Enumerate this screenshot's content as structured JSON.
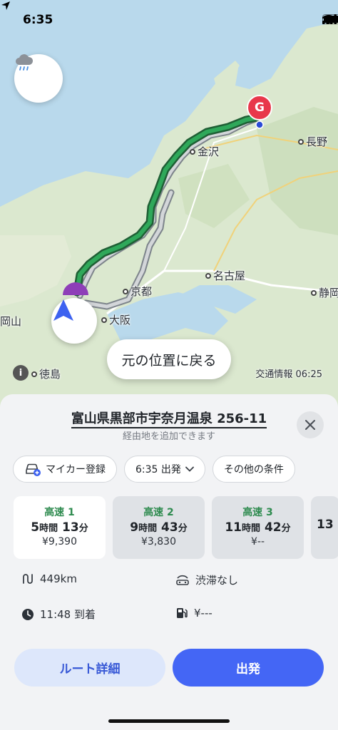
{
  "status_bar": {
    "time": "6:35"
  },
  "map": {
    "labels": {
      "kanazawa": "金沢",
      "nagano": "長野",
      "nagoya": "名古屋",
      "kyoto": "京都",
      "osaka": "大阪",
      "shizuoka": "静岡",
      "okayama": "岡山",
      "tokushima": "徳島"
    },
    "goal_marker": "G",
    "return_button": "元の位置に戻る",
    "info_icon_glyph": "i",
    "traffic_info": "交通情報 06:25",
    "colors": {
      "route_active": "#2e8b4f",
      "route_alt": "#9aa0a6",
      "goal": "#e8384b"
    }
  },
  "sheet": {
    "destination": "富山県黒部市宇奈月温泉 256-11",
    "subtitle": "経由地を追加できます",
    "chips": {
      "mycar": "マイカー登録",
      "departure": "6:35 出発",
      "conditions": "その他の条件"
    },
    "routes": [
      {
        "type": "高速 1",
        "hours": "5",
        "hours_unit": "時間",
        "minutes": "13",
        "minutes_unit": "分",
        "fare": "¥9,390"
      },
      {
        "type": "高速 2",
        "hours": "9",
        "hours_unit": "時間",
        "minutes": "43",
        "minutes_unit": "分",
        "fare": "¥3,830"
      },
      {
        "type": "高速 3",
        "hours": "11",
        "hours_unit": "時間",
        "minutes": "42",
        "minutes_unit": "分",
        "fare": "¥--"
      },
      {
        "hours": "13"
      }
    ],
    "stats": {
      "distance": "449km",
      "traffic": "渋滞なし",
      "arrival": "11:48 到着",
      "fuel": "¥---"
    },
    "buttons": {
      "detail": "ルート詳細",
      "go": "出発"
    }
  }
}
